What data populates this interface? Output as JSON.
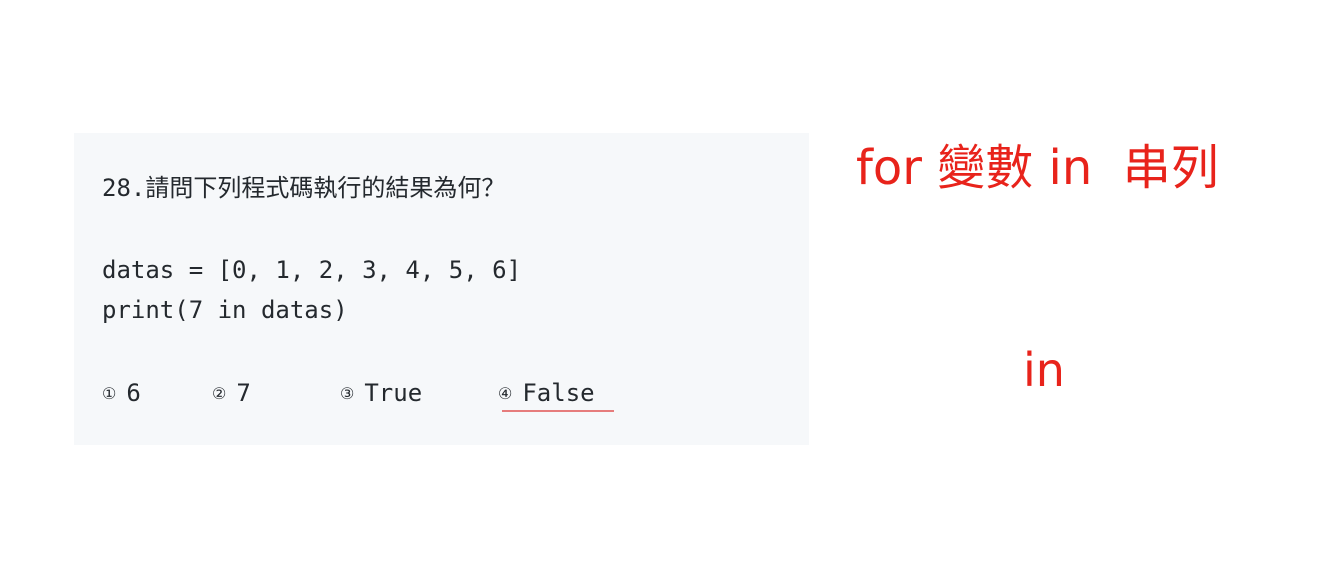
{
  "question": {
    "text": "28.請問下列程式碼執行的結果為何？",
    "code_lines": [
      "datas = [0, 1, 2, 3, 4, 5, 6]",
      "print(7 in datas)"
    ],
    "options": [
      {
        "marker": "①",
        "value": "6"
      },
      {
        "marker": "②",
        "value": "7"
      },
      {
        "marker": "③",
        "value": "True"
      },
      {
        "marker": "④",
        "value": "False"
      }
    ],
    "answer_color": "#e67c7c"
  },
  "annotations": {
    "note_1": "for 變數 in  串列",
    "note_2": "in",
    "color": "#e8231b"
  }
}
